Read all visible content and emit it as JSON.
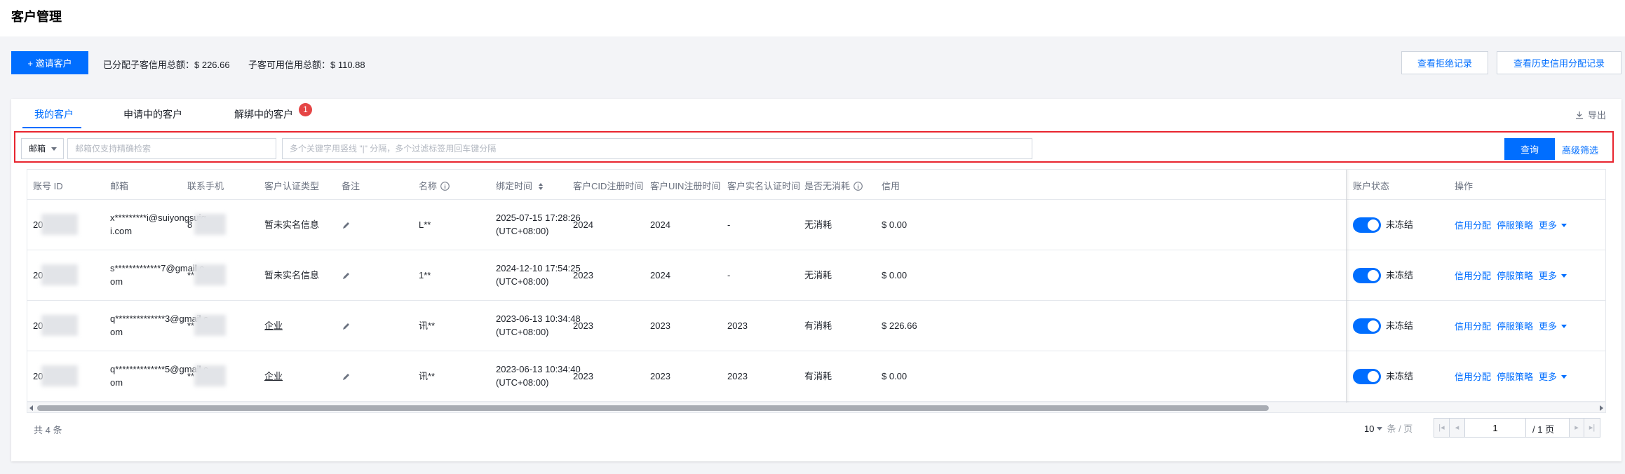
{
  "page": {
    "title": "客户管理"
  },
  "actions": {
    "invite_label": "+ 邀请客户",
    "allocated_credit": "已分配子客信用总额：$ 226.66",
    "available_credit": "子客可用信用总额：$ 110.88",
    "rejected_records_label": "查看拒绝记录",
    "history_records_label": "查看历史信用分配记录"
  },
  "tabs": [
    {
      "label": "我的客户",
      "active": true
    },
    {
      "label": "申请中的客户",
      "active": false
    },
    {
      "label": "解绑中的客户",
      "active": false,
      "badge": "1"
    }
  ],
  "export_label": "导出",
  "filter": {
    "field_select": "邮箱",
    "email_placeholder": "邮箱仅支持精确检索",
    "keyword_placeholder": "多个关键字用竖线 \"|\" 分隔，多个过滤标签用回车键分隔",
    "query_label": "查询",
    "advanced_label": "高级筛选"
  },
  "table": {
    "columns": [
      "账号 ID",
      "邮箱",
      "联系手机",
      "客户认证类型",
      "备注",
      "名称",
      "绑定时间",
      "客户CID注册时间",
      "客户UIN注册时间",
      "客户实名认证时间",
      "是否无消耗",
      "信用",
      "账户状态",
      "操作"
    ],
    "rows": [
      {
        "id_prefix": "20",
        "email": "x*********i@suiyongsuiqi.com",
        "phone_prefix": "8",
        "auth_type": "暂未实名信息",
        "auth_link": false,
        "name": "L**",
        "bind_time": "2025-07-15 17:28:26",
        "bind_tz": "(UTC+08:00)",
        "cid_time": "2024",
        "uin_time": "2024",
        "real_time": "-",
        "no_consumption": "无消耗",
        "credit": "$ 0.00",
        "status": "未冻结"
      },
      {
        "id_prefix": "20",
        "email": "s*************7@gmail.com",
        "phone_prefix": "**",
        "auth_type": "暂未实名信息",
        "auth_link": false,
        "name": "1**",
        "bind_time": "2024-12-10 17:54:25",
        "bind_tz": "(UTC+08:00)",
        "cid_time": "2023",
        "uin_time": "2024",
        "real_time": "-",
        "no_consumption": "无消耗",
        "credit": "$ 0.00",
        "status": "未冻结"
      },
      {
        "id_prefix": "20",
        "email": "q**************3@gmail.com",
        "phone_prefix": "**",
        "auth_type": "企业",
        "auth_link": true,
        "name": "讯**",
        "bind_time": "2023-06-13 10:34:48",
        "bind_tz": "(UTC+08:00)",
        "cid_time": "2023",
        "uin_time": "2023",
        "real_time": "2023",
        "no_consumption": "有消耗",
        "credit": "$ 226.66",
        "status": "未冻结"
      },
      {
        "id_prefix": "20",
        "email": "q**************5@gmail.com",
        "phone_prefix": "**",
        "auth_type": "企业",
        "auth_link": true,
        "name": "讯**",
        "bind_time": "2023-06-13 10:34:40",
        "bind_tz": "(UTC+08:00)",
        "cid_time": "2023",
        "uin_time": "2023",
        "real_time": "2023",
        "no_consumption": "有消耗",
        "credit": "$ 0.00",
        "status": "未冻结"
      }
    ],
    "op_credit": "信用分配",
    "op_stop": "停服策略",
    "op_more": "更多"
  },
  "footer": {
    "total": "共 4 条",
    "page_size": "10",
    "page_size_unit": "条 / 页",
    "current_page": "1",
    "total_pages": "/ 1 页"
  },
  "colors": {
    "primary": "#006eff",
    "danger": "#e54545",
    "highlight_border": "#e8252f"
  }
}
